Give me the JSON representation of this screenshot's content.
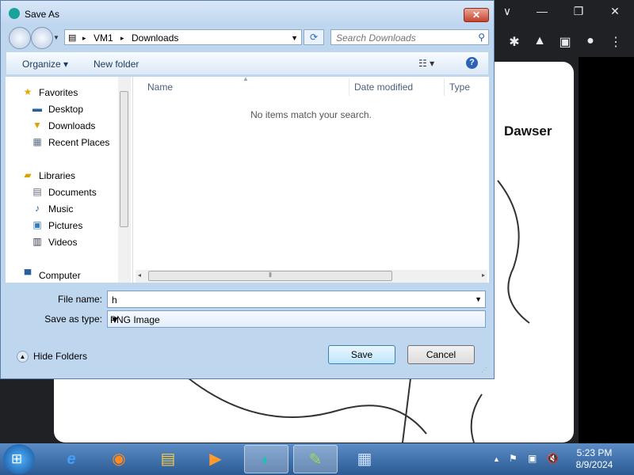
{
  "browser": {
    "canvas_text": "Dawser",
    "window_controls": {
      "minimize": "∨",
      "minimize2": "—",
      "restore": "❐",
      "close": "✕"
    },
    "extensions": {
      "puzzle": "✱",
      "lab": "▲",
      "panel": "▣",
      "profile": "●",
      "menu": "⋮"
    }
  },
  "dialog": {
    "title": "Save As",
    "close_label": "✕",
    "address": {
      "segments": [
        "VM1",
        "Downloads"
      ],
      "sep": "▸"
    },
    "search_placeholder": "Search Downloads",
    "toolbar": {
      "organize": "Organize ▾",
      "new_folder": "New folder",
      "views": "☷ ▾",
      "help": "?"
    },
    "nav": {
      "items": [
        {
          "label": "Favorites",
          "icon": "star-icon"
        },
        {
          "label": "Desktop",
          "icon": "desktop-icon"
        },
        {
          "label": "Downloads",
          "icon": "downloads-icon"
        },
        {
          "label": "Recent Places",
          "icon": "recent-places-icon"
        },
        {
          "label": "Libraries",
          "icon": "libraries-icon"
        },
        {
          "label": "Documents",
          "icon": "documents-icon"
        },
        {
          "label": "Music",
          "icon": "music-icon"
        },
        {
          "label": "Pictures",
          "icon": "pictures-icon"
        },
        {
          "label": "Videos",
          "icon": "videos-icon"
        },
        {
          "label": "Computer",
          "icon": "computer-icon"
        }
      ]
    },
    "columns": [
      "Name",
      "Date modified",
      "Type"
    ],
    "empty_message": "No items match your search.",
    "file_name_label": "File name:",
    "file_name_value": "h",
    "save_as_type_label": "Save as type:",
    "save_as_type_value": "PNG Image",
    "hide_folders": "Hide Folders",
    "save_button": "Save",
    "cancel_button": "Cancel"
  },
  "taskbar": {
    "items": [
      {
        "name": "internet-explorer",
        "glyph": "e"
      },
      {
        "name": "firefox",
        "glyph": "◉"
      },
      {
        "name": "file-explorer",
        "glyph": "▤"
      },
      {
        "name": "media-player",
        "glyph": "▶"
      },
      {
        "name": "browser-app",
        "glyph": "◐"
      },
      {
        "name": "paint-app",
        "glyph": "✎"
      },
      {
        "name": "remote-desktop",
        "glyph": "▦"
      }
    ],
    "tray": {
      "chevron": "▲",
      "flag": "⚑",
      "network": "▣",
      "volume": "🔇"
    },
    "time": "5:23 PM",
    "date": "8/9/2024"
  }
}
